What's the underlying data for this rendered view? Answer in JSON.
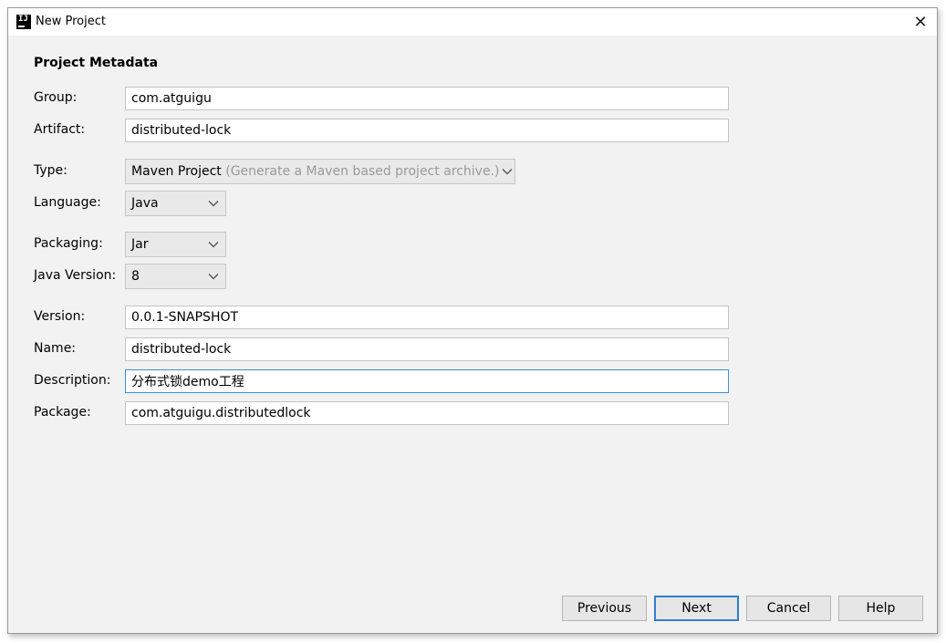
{
  "window": {
    "title": "New Project",
    "close_glyph": "✕"
  },
  "section": {
    "title": "Project Metadata"
  },
  "fields": {
    "group": {
      "label": "Group:",
      "value": "com.atguigu"
    },
    "artifact": {
      "label": "Artifact:",
      "value": "distributed-lock"
    },
    "type": {
      "label": "Type:",
      "value": "Maven Project",
      "hint": "(Generate a Maven based project archive.)"
    },
    "language": {
      "label": "Language:",
      "value": "Java"
    },
    "packaging": {
      "label": "Packaging:",
      "value": "Jar"
    },
    "java_version": {
      "label": "Java Version:",
      "value": "8"
    },
    "version": {
      "label": "Version:",
      "value": "0.0.1-SNAPSHOT"
    },
    "name": {
      "label": "Name:",
      "value": "distributed-lock"
    },
    "description": {
      "label": "Description:",
      "value": "分布式锁demo工程"
    },
    "package": {
      "label": "Package:",
      "value": "com.atguigu.distributedlock"
    }
  },
  "buttons": {
    "previous": "Previous",
    "next": "Next",
    "cancel": "Cancel",
    "help": "Help"
  },
  "colors": {
    "focus_border": "#3a8fd6",
    "default_button_border": "#2f7fd0"
  },
  "icons": {
    "app": "intellij-idea-icon",
    "close": "close-icon",
    "dropdown": "chevron-down-icon"
  }
}
